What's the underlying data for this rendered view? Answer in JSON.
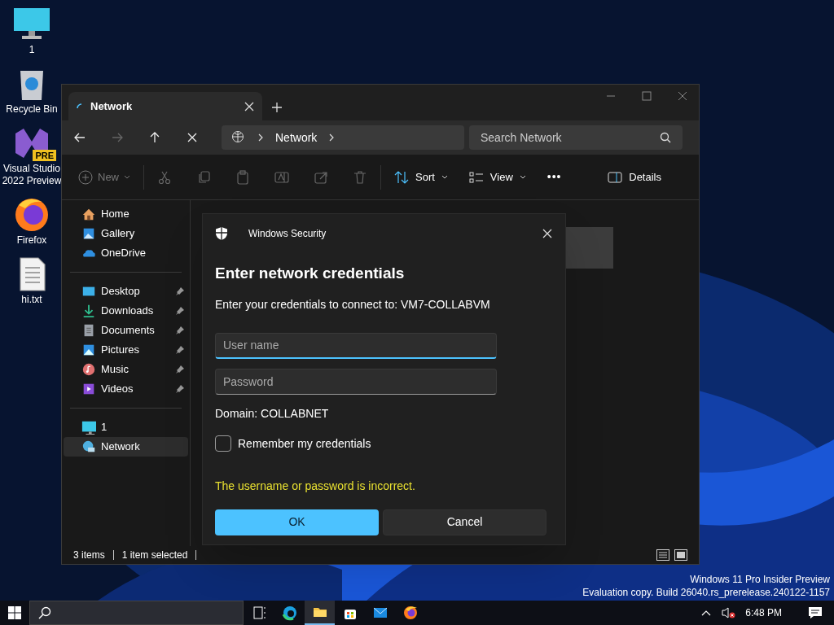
{
  "desktop_icons": [
    {
      "kind": "monitor",
      "label": "1"
    },
    {
      "kind": "recycle",
      "label": "Recycle Bin"
    },
    {
      "kind": "vs",
      "label": "Visual Studio 2022 Preview",
      "badge": "PRE"
    },
    {
      "kind": "firefox",
      "label": "Firefox"
    },
    {
      "kind": "text",
      "label": "hi.txt"
    }
  ],
  "explorer": {
    "tab": {
      "title": "Network",
      "loading": true
    },
    "address": {
      "crumbs": [
        "Network"
      ]
    },
    "search": {
      "placeholder": "Search Network"
    },
    "toolbar": {
      "new": "New",
      "sort": "Sort",
      "view": "View",
      "more": "•••",
      "details": "Details"
    },
    "nav_groups": [
      [
        {
          "kind": "home",
          "label": "Home",
          "selected": false
        },
        {
          "kind": "gallery",
          "label": "Gallery",
          "selected": false
        },
        {
          "kind": "onedrive",
          "label": "OneDrive",
          "selected": false
        }
      ],
      [
        {
          "kind": "desktop",
          "label": "Desktop",
          "pinned": true,
          "selected": false
        },
        {
          "kind": "downloads",
          "label": "Downloads",
          "pinned": true,
          "selected": false
        },
        {
          "kind": "documents",
          "label": "Documents",
          "pinned": true,
          "selected": false
        },
        {
          "kind": "pictures",
          "label": "Pictures",
          "pinned": true,
          "selected": false
        },
        {
          "kind": "music",
          "label": "Music",
          "pinned": true,
          "selected": false
        },
        {
          "kind": "videos",
          "label": "Videos",
          "pinned": true,
          "selected": false
        }
      ],
      [
        {
          "kind": "monitor",
          "label": "1",
          "selected": false
        },
        {
          "kind": "network",
          "label": "Network",
          "selected": true
        }
      ]
    ],
    "status_bar": [
      "3 items",
      "1 item selected"
    ]
  },
  "dialog": {
    "title": "Windows Security",
    "heading": "Enter network credentials",
    "prompt": "Enter your credentials to connect to: VM7-COLLABVM",
    "username": {
      "placeholder": "User name"
    },
    "password": {
      "placeholder": "Password"
    },
    "domain": "Domain: COLLABNET",
    "remember": {
      "label": "Remember my credentials",
      "checked": false
    },
    "error": "The username or password is incorrect.",
    "buttons": [
      "OK",
      "Cancel"
    ]
  },
  "watermark": [
    "Windows 11 Pro Insider Preview",
    "Evaluation copy. Build 26040.rs_prerelease.240122-1157"
  ],
  "taskbar": {
    "apps": [
      {
        "kind": "taskview",
        "active": false
      },
      {
        "kind": "edge",
        "active": false
      },
      {
        "kind": "explorer",
        "active": true
      },
      {
        "kind": "store",
        "active": false
      },
      {
        "kind": "mail",
        "active": false
      },
      {
        "kind": "firefox",
        "active": false
      }
    ],
    "clock": "6:48 PM"
  }
}
